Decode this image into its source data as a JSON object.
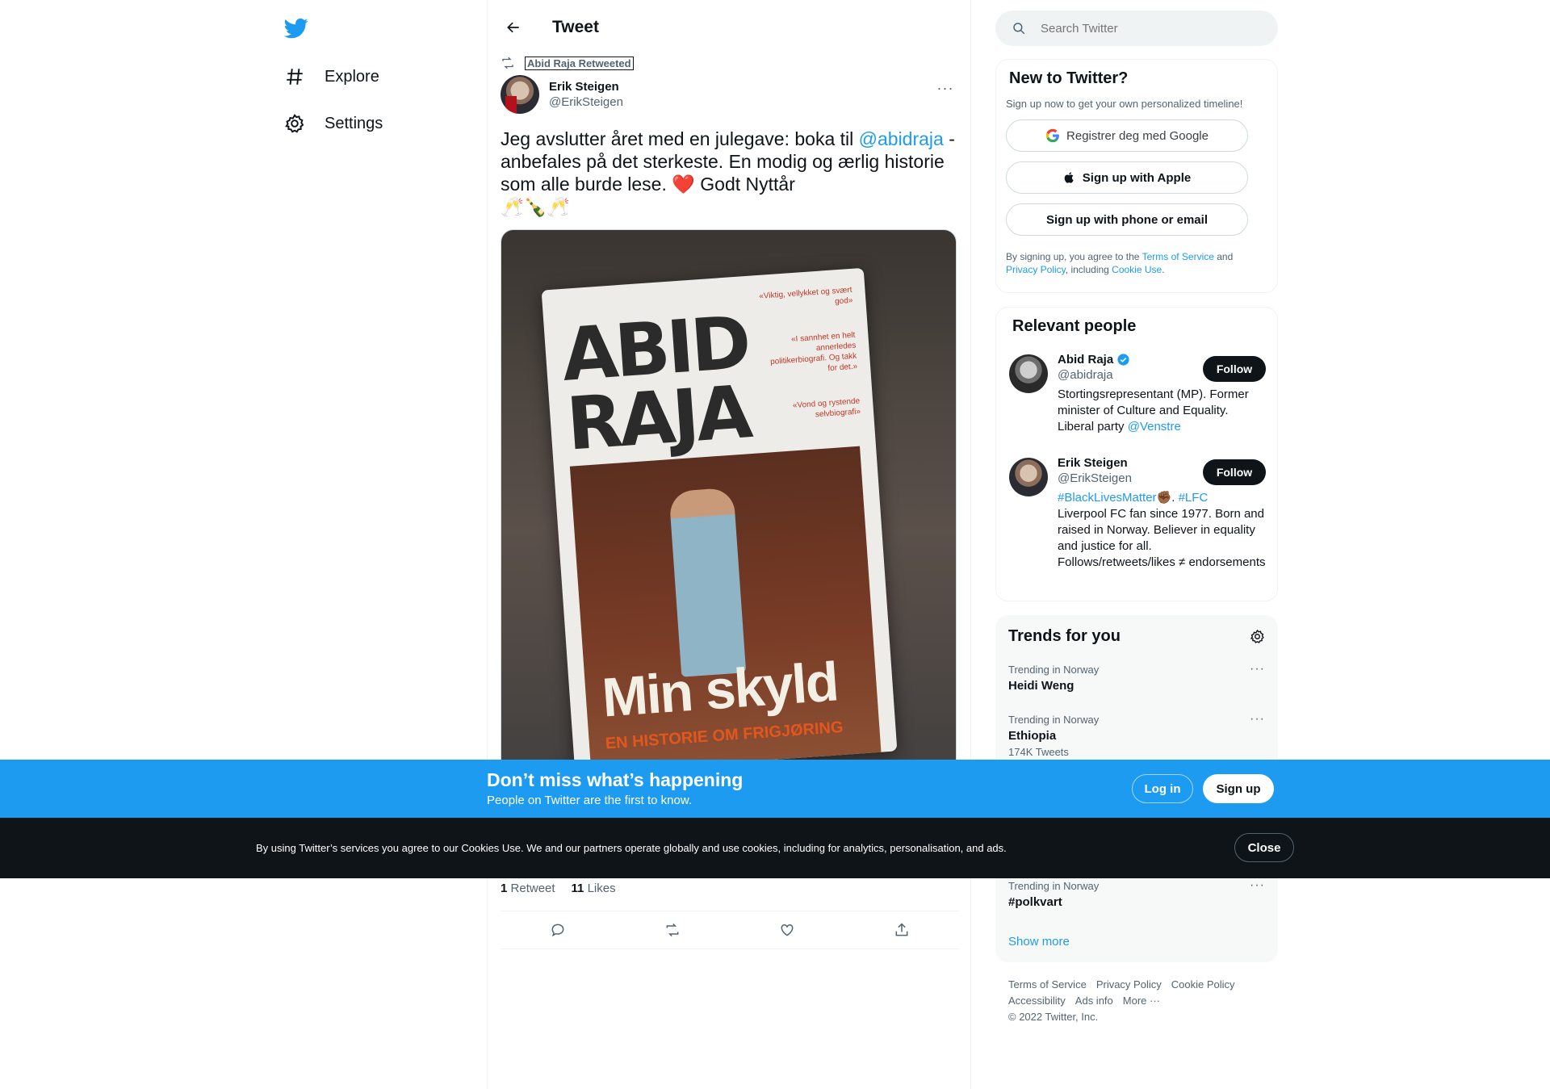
{
  "nav": {
    "explore_label": "Explore",
    "settings_label": "Settings"
  },
  "header": {
    "title": "Tweet"
  },
  "tweet": {
    "retweeted_by": "Abid Raja Retweeted",
    "author_name": "Erik Steigen",
    "author_handle": "@ErikSteigen",
    "text_part1": "Jeg avslutter året med en julegave: boka til ",
    "mention": "@abidraja",
    "text_part2": " - anbefales på det sterkeste. En modig og ærlig historie som alle burde lese. ",
    "heart": "❤️",
    "text_part3": " Godt Nyttår",
    "emoji_line": "🥂🍾🥂",
    "media": {
      "book_title": "ABID RAJA",
      "book_subtitle": "Min skyld",
      "book_tagline": "EN HISTORIE OM FRIGJØRING",
      "quotes": [
        "«Viktig, vellykket og svært god»",
        "«I sannhet en helt annerledes politikerbiografi. Og takk for det.»",
        "«Vond og rystende selvbiografi»"
      ]
    },
    "retweet_count": "1",
    "retweet_label": "Retweet",
    "like_count": "11",
    "like_label": "Likes"
  },
  "search": {
    "placeholder": "Search Twitter"
  },
  "new_to_twitter": {
    "title": "New to Twitter?",
    "subtitle": "Sign up now to get your own personalized timeline!",
    "google_label": "Registrer deg med Google",
    "apple_label": "Sign up with Apple",
    "phone_label": "Sign up with phone or email",
    "legal_1": "By signing up, you agree to the ",
    "legal_terms": "Terms of Service",
    "legal_2": " and ",
    "legal_privacy": "Privacy Policy",
    "legal_3": ", including ",
    "legal_cookie": "Cookie Use",
    "legal_4": "."
  },
  "relevant_people": {
    "title": "Relevant people",
    "people": [
      {
        "name": "Abid Raja",
        "handle": "@abidraja",
        "bio": "Stortingsrepresentant (MP). Former minister of Culture and Equality. Liberal party ",
        "bio_link": "@Venstre",
        "follow_label": "Follow"
      },
      {
        "name": "Erik Steigen",
        "handle": "@ErikSteigen",
        "bio_tag1": "#BlackLivesMatter",
        "bio_emoji": "✊🏾",
        "bio_sep": ". ",
        "bio_tag2": "#LFC",
        "bio": "Liverpool FC fan since 1977. Born and raised in Norway. Believer in equality and justice for all. Follows/retweets/likes ≠ endorsements",
        "follow_label": "Follow"
      }
    ]
  },
  "trends": {
    "title": "Trends for you",
    "items": [
      {
        "meta": "Trending in Norway",
        "name": "Heidi Weng",
        "count": ""
      },
      {
        "meta": "Trending in Norway",
        "name": "Ethiopia",
        "count": "174K Tweets"
      },
      {
        "meta": "Trending in Norway",
        "name": "#polkvart",
        "count": ""
      }
    ],
    "show_more": "Show more"
  },
  "footer": {
    "links": [
      "Terms of Service",
      "Privacy Policy",
      "Cookie Policy",
      "Accessibility",
      "Ads info",
      "More ···"
    ],
    "copyright": "© 2022 Twitter, Inc."
  },
  "banner": {
    "title": "Don’t miss what’s happening",
    "subtitle": "People on Twitter are the first to know.",
    "login_label": "Log in",
    "signup_label": "Sign up"
  },
  "cookie": {
    "text": "By using Twitter’s services you agree to our Cookies Use. We and our partners operate globally and use cookies, including for analytics, personalisation, and ads.",
    "close_label": "Close"
  },
  "colors": {
    "accent": "#1d9bf0",
    "text_primary": "#0f1419",
    "text_secondary": "#536471",
    "cookie_bar": "#0f1419"
  }
}
